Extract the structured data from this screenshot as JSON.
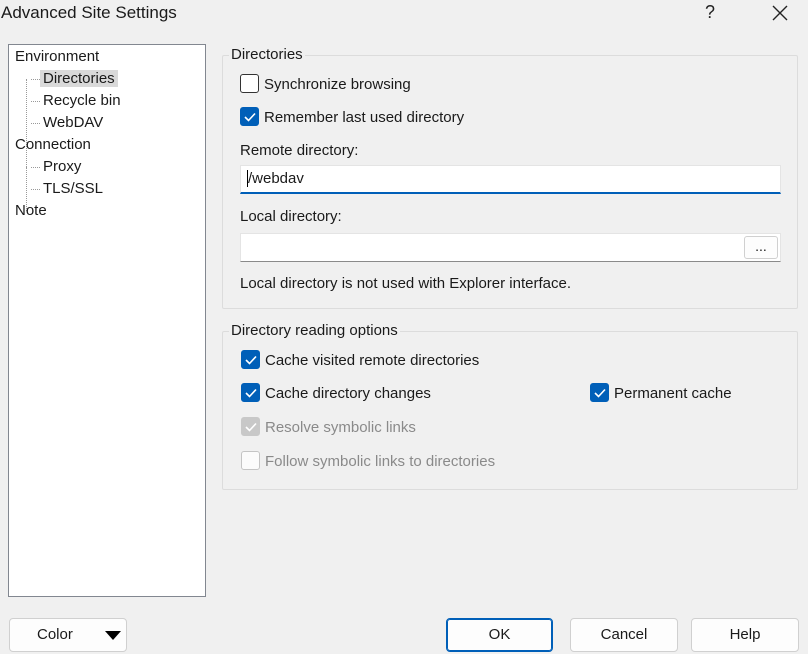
{
  "window": {
    "title": "Advanced Site Settings",
    "help_label": "?",
    "close_icon": "close-icon"
  },
  "tree": {
    "items": [
      {
        "label": "Environment",
        "level": 0,
        "selected": false
      },
      {
        "label": "Directories",
        "level": 1,
        "selected": true
      },
      {
        "label": "Recycle bin",
        "level": 1,
        "selected": false
      },
      {
        "label": "WebDAV",
        "level": 1,
        "selected": false
      },
      {
        "label": "Connection",
        "level": 0,
        "selected": false
      },
      {
        "label": "Proxy",
        "level": 1,
        "selected": false
      },
      {
        "label": "TLS/SSL",
        "level": 1,
        "selected": false
      },
      {
        "label": "Note",
        "level": 0,
        "selected": false
      }
    ]
  },
  "directories": {
    "group_title": "Directories",
    "synchronize_browsing": {
      "label": "Synchronize browsing",
      "checked": false
    },
    "remember_last_dir": {
      "label": "Remember last used directory",
      "checked": true
    },
    "remote_dir_label": "Remote directory:",
    "remote_dir_value": "/webdav",
    "local_dir_label": "Local directory:",
    "local_dir_value": "",
    "browse_label": "...",
    "local_dir_note": "Local directory is not used with Explorer interface."
  },
  "reading": {
    "group_title": "Directory reading options",
    "cache_visited": {
      "label": "Cache visited remote directories",
      "checked": true
    },
    "cache_changes": {
      "label": "Cache directory changes",
      "checked": true
    },
    "permanent_cache": {
      "label": "Permanent cache",
      "checked": true
    },
    "resolve_symlinks": {
      "label": "Resolve symbolic links",
      "checked": true,
      "disabled": true
    },
    "follow_symlinks": {
      "label": "Follow symbolic links to directories",
      "checked": false,
      "disabled": true
    }
  },
  "buttons": {
    "color": "Color",
    "ok": "OK",
    "cancel": "Cancel",
    "help": "Help"
  },
  "colors": {
    "accent": "#005fb8",
    "background": "#f0f0f0"
  }
}
